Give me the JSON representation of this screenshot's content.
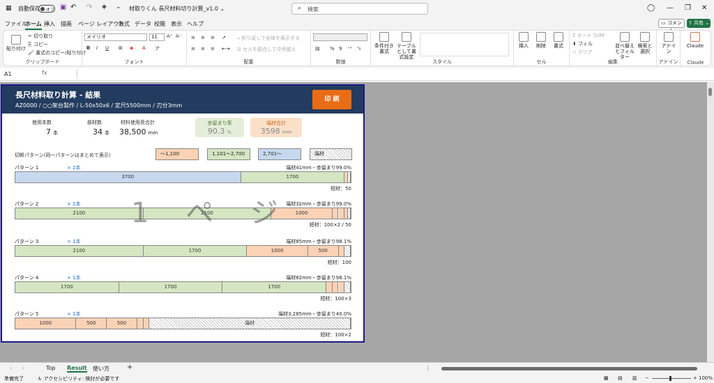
{
  "titlebar": {
    "autosave_label": "自動保存",
    "autosave_state": "オフ",
    "doc_title": "材取りくん 長尺材料切り計算_v1.0 ⌄",
    "search_placeholder": "検索"
  },
  "ribbon_tabs": [
    "ファイル",
    "ホーム",
    "挿入",
    "描画",
    "ページ レイアウト",
    "数式",
    "データ",
    "校閲",
    "表示",
    "ヘルプ"
  ],
  "active_tab": "ホーム",
  "actions": {
    "comment": "コメント",
    "share": "共有 ⌄"
  },
  "ribbon": {
    "clipboard": {
      "paste": "貼り付け",
      "cut": "切り取り",
      "copy": "コピー",
      "format_painter": "書式のコピー/貼り付け",
      "label": "クリップボード"
    },
    "font": {
      "name": "メイリオ",
      "size": "11",
      "label": "フォント"
    },
    "alignment": {
      "wrap": "折り返して全体を表示する",
      "merge": "セルを結合して中央揃え",
      "label": "配置"
    },
    "number": {
      "label": "数値"
    },
    "style": {
      "conditional": "条件付き書式",
      "table": "テーブルとして書式設定",
      "label": "スタイル"
    },
    "cells": {
      "insert": "挿入",
      "delete": "削除",
      "format": "書式",
      "label": "セル"
    },
    "edit": {
      "autosum": "オート SUM",
      "fill": "フィル",
      "clear": "クリア",
      "sort": "並べ替えとフィルター",
      "find": "検索と選択",
      "label": "編集"
    },
    "addin": {
      "addin": "アドイン",
      "label": "アドイン"
    },
    "claude": {
      "btn": "Claude",
      "label": "Claude"
    }
  },
  "formula_bar": {
    "name_box": "A1",
    "fx": "fx"
  },
  "result": {
    "title": "長尺材料取り計算 - 結果",
    "subtitle": "AZ0000 / ○○架台製作 / L-50x50x6 / 定尺5500mm / 刃分3mm",
    "print": "印 刷",
    "stats": [
      {
        "label": "使用本数",
        "value": "7",
        "unit": "本"
      },
      {
        "label": "部材数",
        "value": "34",
        "unit": "本"
      },
      {
        "label": "材料使用長合計",
        "value": "38,500",
        "unit": "mm"
      }
    ],
    "yield_box": {
      "label": "歩留まり率",
      "value": "90.3",
      "unit": "%",
      "color": "#e4edda"
    },
    "scrap_box": {
      "label": "端材合計",
      "value": "3598",
      "unit": "mm",
      "color": "#fbe0c9"
    },
    "legend_title": "切断パターン(同一パターンはまとめて表示)",
    "legend": [
      {
        "label": "～1,100",
        "class": "c1"
      },
      {
        "label": "1,101～2,700",
        "class": "c2"
      },
      {
        "label": "2,701～",
        "class": "c3"
      },
      {
        "label": "端材",
        "class": "c4"
      }
    ],
    "watermark": "1 ペ ジ",
    "patterns": [
      {
        "name": "パターン 1",
        "count": "× 2本",
        "info": "端材41mm・歩留まり99.0%",
        "short": "短材：50",
        "segments": [
          {
            "label": "3700",
            "len": 3700,
            "cls": "c3"
          },
          {
            "label": "1700",
            "len": 1700,
            "cls": "c2"
          },
          {
            "label": "",
            "len": 50,
            "cls": "c1"
          },
          {
            "label": "",
            "len": 50,
            "cls": "c4"
          }
        ]
      },
      {
        "name": "パターン 2",
        "count": "× 2本",
        "info": "端材32mm・歩留まり99.0%",
        "short": "短材：100×2 / 50",
        "segments": [
          {
            "label": "2100",
            "len": 2100,
            "cls": "c2"
          },
          {
            "label": "2100",
            "len": 2100,
            "cls": "c2"
          },
          {
            "label": "1000",
            "len": 1000,
            "cls": "c1"
          },
          {
            "label": "",
            "len": 100,
            "cls": "c1"
          },
          {
            "label": "",
            "len": 100,
            "cls": "c1"
          },
          {
            "label": "",
            "len": 50,
            "cls": "c1"
          },
          {
            "label": "",
            "len": 50,
            "cls": "c4"
          }
        ]
      },
      {
        "name": "パターン 3",
        "count": "× 1本",
        "info": "端材85mm・歩留まり98.1%",
        "short": "短材：100",
        "segments": [
          {
            "label": "2100",
            "len": 2100,
            "cls": "c2"
          },
          {
            "label": "1700",
            "len": 1700,
            "cls": "c2"
          },
          {
            "label": "1000",
            "len": 1000,
            "cls": "c1"
          },
          {
            "label": "500",
            "len": 500,
            "cls": "c1"
          },
          {
            "label": "",
            "len": 100,
            "cls": "c1"
          },
          {
            "label": "",
            "len": 100,
            "cls": "c4"
          }
        ]
      },
      {
        "name": "パターン 4",
        "count": "× 1本",
        "info": "端材82mm・歩留まり98.1%",
        "short": "短材：100×3",
        "segments": [
          {
            "label": "1700",
            "len": 1700,
            "cls": "c2"
          },
          {
            "label": "1700",
            "len": 1700,
            "cls": "c2"
          },
          {
            "label": "1700",
            "len": 1700,
            "cls": "c2"
          },
          {
            "label": "",
            "len": 100,
            "cls": "c1"
          },
          {
            "label": "",
            "len": 100,
            "cls": "c1"
          },
          {
            "label": "",
            "len": 100,
            "cls": "c1"
          },
          {
            "label": "",
            "len": 100,
            "cls": "c4"
          }
        ]
      },
      {
        "name": "パターン 5",
        "count": "× 1本",
        "info": "端材3,285mm・歩留まり40.0%",
        "short": "短材：100×2",
        "segments": [
          {
            "label": "1000",
            "len": 1000,
            "cls": "c1"
          },
          {
            "label": "500",
            "len": 500,
            "cls": "c1"
          },
          {
            "label": "500",
            "len": 500,
            "cls": "c1"
          },
          {
            "label": "",
            "len": 100,
            "cls": "c1"
          },
          {
            "label": "",
            "len": 100,
            "cls": "c1"
          },
          {
            "label": "端材",
            "len": 3300,
            "cls": "c4"
          }
        ]
      }
    ]
  },
  "sheet_tabs": [
    "Top",
    "Result",
    "使い方"
  ],
  "active_sheet": "Result",
  "status": {
    "ready": "準備完了",
    "accessibility": "アクセシビリティ: 検討が必要です",
    "zoom": "100%"
  }
}
